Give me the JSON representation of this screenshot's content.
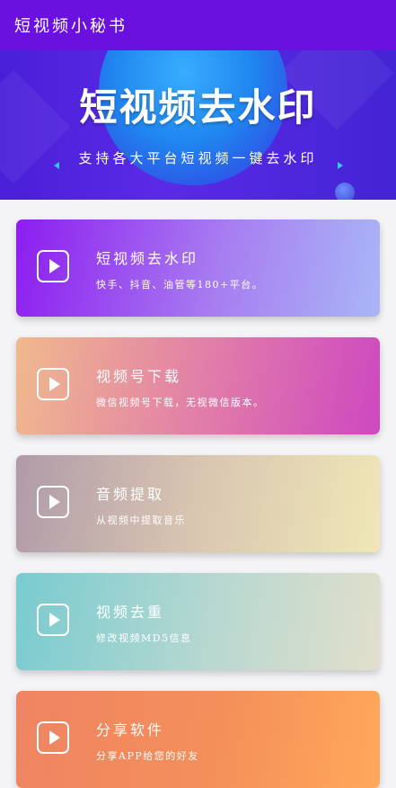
{
  "appbar": {
    "title": "短视频小秘书"
  },
  "banner": {
    "headline": "短视频去水印",
    "subline": "支持各大平台短视频一键去水印"
  },
  "cards": [
    {
      "title": "短视频去水印",
      "desc": "快手、抖音、油管等180+平台。"
    },
    {
      "title": "视频号下载",
      "desc": "微信视频号下载，无视微信版本。"
    },
    {
      "title": "音频提取",
      "desc": "从视频中提取音乐"
    },
    {
      "title": "视频去重",
      "desc": "修改视频MD5信息"
    },
    {
      "title": "分享软件",
      "desc": "分享APP给您的好友"
    }
  ],
  "colors": {
    "appbar": "#6a11e0",
    "background": "#f4f4f6"
  },
  "icons": {
    "card_icon": "play-icon"
  }
}
